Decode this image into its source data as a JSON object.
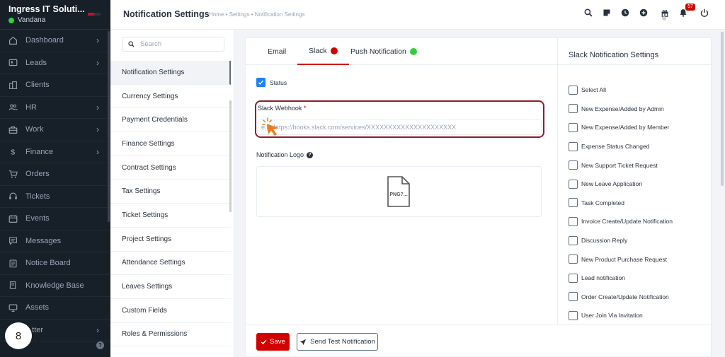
{
  "brand": {
    "name": "Ingress IT Soluti...",
    "user": "Vandana"
  },
  "sidebar": {
    "items": [
      {
        "label": "Dashboard",
        "icon": "home-icon",
        "has_chevron": true
      },
      {
        "label": "Leads",
        "icon": "contact-card-icon",
        "has_chevron": true
      },
      {
        "label": "Clients",
        "icon": "building-icon",
        "has_chevron": false
      },
      {
        "label": "HR",
        "icon": "people-icon",
        "has_chevron": true
      },
      {
        "label": "Work",
        "icon": "briefcase-icon",
        "has_chevron": true
      },
      {
        "label": "Finance",
        "icon": "dollar-icon",
        "has_chevron": true
      },
      {
        "label": "Orders",
        "icon": "cart-icon",
        "has_chevron": false
      },
      {
        "label": "Tickets",
        "icon": "headset-icon",
        "has_chevron": false
      },
      {
        "label": "Events",
        "icon": "calendar-icon",
        "has_chevron": false
      },
      {
        "label": "Messages",
        "icon": "chat-icon",
        "has_chevron": false
      },
      {
        "label": "Notice Board",
        "icon": "clipboard-icon",
        "has_chevron": false
      },
      {
        "label": "Knowledge Base",
        "icon": "book-icon",
        "has_chevron": false
      },
      {
        "label": "Assets",
        "icon": "monitor-icon",
        "has_chevron": false
      },
      {
        "label": "...tter",
        "icon": "letter-icon",
        "has_chevron": true
      }
    ],
    "bubble_count": "8",
    "help": "?"
  },
  "header": {
    "title": "Notification Settings",
    "breadcrumb": "Home • Settings • Notification Settings",
    "notification_count": "57"
  },
  "settings_menu": {
    "search_placeholder": "Search",
    "items": [
      "Notification Settings",
      "Currency Settings",
      "Payment Credentials",
      "Finance Settings",
      "Contract Settings",
      "Tax Settings",
      "Ticket Settings",
      "Project Settings",
      "Attendance Settings",
      "Leaves Settings",
      "Custom Fields",
      "Roles & Permissions"
    ],
    "active_index": 0
  },
  "tabs": [
    {
      "label": "Email",
      "dot_color": null
    },
    {
      "label": "Slack",
      "dot_color": "#d30000"
    },
    {
      "label": "Push Notification",
      "dot_color": "#2fd136"
    }
  ],
  "form": {
    "status_label": "Status",
    "status_checked": true,
    "webhook_label": "Slack Webhook",
    "required_mark": "*",
    "webhook_placeholder": "e.g. https://hooks.slack.com/services/XXXXXXXXXXXXXXXXXXXXX",
    "webhook_value": "",
    "logo_label": "Notification Logo",
    "logo_placeholder": "PNG?..."
  },
  "right_panel": {
    "title": "Slack Notification Settings",
    "options": [
      "Select All",
      "New Expense/Added by Admin",
      "New Expense/Added by Member",
      "Expense Status Changed",
      "New Support Ticket Request",
      "New Leave Application",
      "Task Completed",
      "Invoice Create/Update Notification",
      "Discussion Reply",
      "New Product Purchase Request",
      "Lead notification",
      "Order Create/Update Notification",
      "User Join Via Invitation"
    ]
  },
  "footer": {
    "save_label": "Save",
    "test_label": "Send Test Notification"
  },
  "colors": {
    "accent": "#d30000",
    "sidebar_bg": "#171f29",
    "checkbox_blue": "#1d82f5",
    "highlight_border": "#8f1d2c",
    "cursor_orange": "#f27b21"
  }
}
